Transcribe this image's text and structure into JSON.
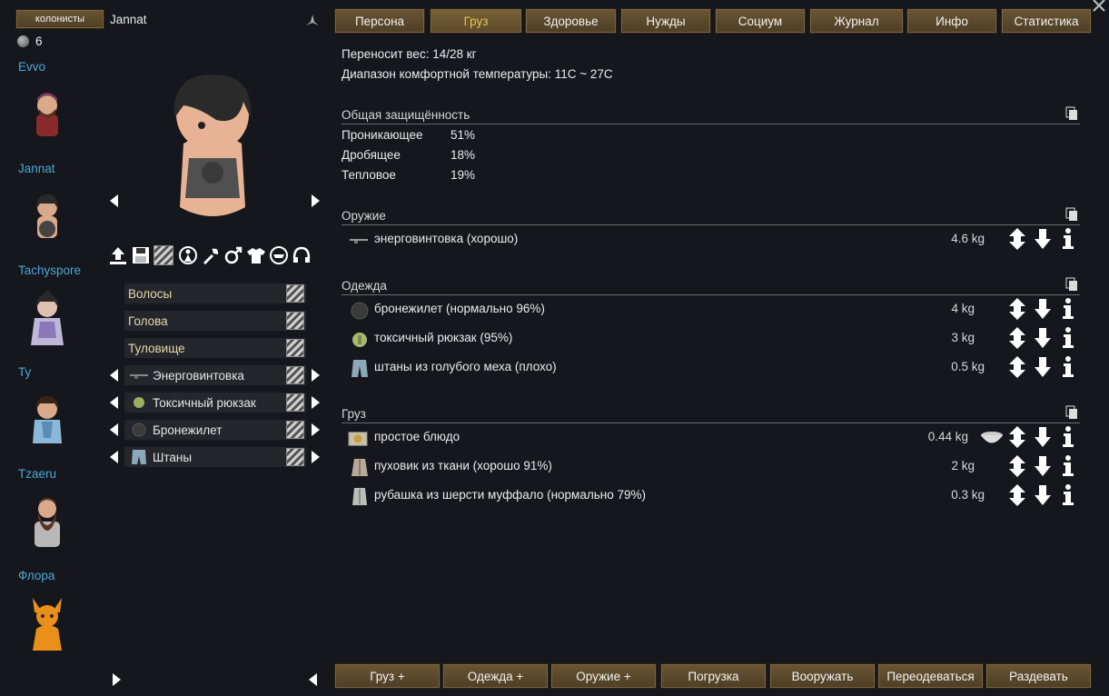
{
  "colonists_button": "колонисты",
  "selected_name": "Jannat",
  "colonist_count": "6",
  "colonists": [
    {
      "name": "Evvo"
    },
    {
      "name": "Jannat"
    },
    {
      "name": "Tachyspore"
    },
    {
      "name": "Ty"
    },
    {
      "name": "Tzaeru"
    },
    {
      "name": "Флора"
    }
  ],
  "slots": [
    {
      "label": "Волосы",
      "empty": true
    },
    {
      "label": "Голова",
      "empty": true
    },
    {
      "label": "Туловище",
      "empty": true
    },
    {
      "label": "Энерговинтовка",
      "empty": false
    },
    {
      "label": "Токсичный рюкзак",
      "empty": false
    },
    {
      "label": "Бронежилет",
      "empty": false
    },
    {
      "label": "Штаны",
      "empty": false
    }
  ],
  "tabs": [
    "Персона",
    "Груз",
    "Здоровье",
    "Нужды",
    "Социум",
    "Журнал",
    "Инфо",
    "Статистика"
  ],
  "active_tab": "Груз",
  "carry_weight": "Переносит вес: 14/28 кг",
  "comfort_temp": "Диапазон комфортной температуры: 11C ~ 27C",
  "armor": {
    "title": "Общая защищённость",
    "rows": [
      {
        "label": "Проникающее",
        "value": "51%"
      },
      {
        "label": "Дробящее",
        "value": "18%"
      },
      {
        "label": "Тепловое",
        "value": "19%"
      }
    ]
  },
  "weapons": {
    "title": "Оружие",
    "items": [
      {
        "name": "энерговинтовка (хорошо)",
        "weight": "4.6 kg"
      }
    ]
  },
  "apparel": {
    "title": "Одежда",
    "items": [
      {
        "name": "бронежилет (нормально 96%)",
        "weight": "4 kg"
      },
      {
        "name": "токсичный рюкзак (95%)",
        "weight": "3 kg"
      },
      {
        "name": "штаны из голубого меха (плохо)",
        "weight": "0.5 kg"
      }
    ]
  },
  "cargo": {
    "title": "Груз",
    "items": [
      {
        "name": "простое блюдо",
        "weight": "0.44 kg"
      },
      {
        "name": "пуховик из ткани (хорошо 91%)",
        "weight": "2 kg"
      },
      {
        "name": "рубашка из шерсти муффало (нормально 79%)",
        "weight": "0.3 kg"
      }
    ]
  },
  "bottom_buttons": [
    "Груз +",
    "Одежда +",
    "Оружие +",
    "Погрузка",
    "Вооружать",
    "Переодеваться",
    "Раздевать"
  ],
  "colors": {
    "background": "#15171c",
    "button": "#5a4830",
    "active_tab_text": "#e8c84e",
    "colonist_name": "#4aa8d8"
  }
}
